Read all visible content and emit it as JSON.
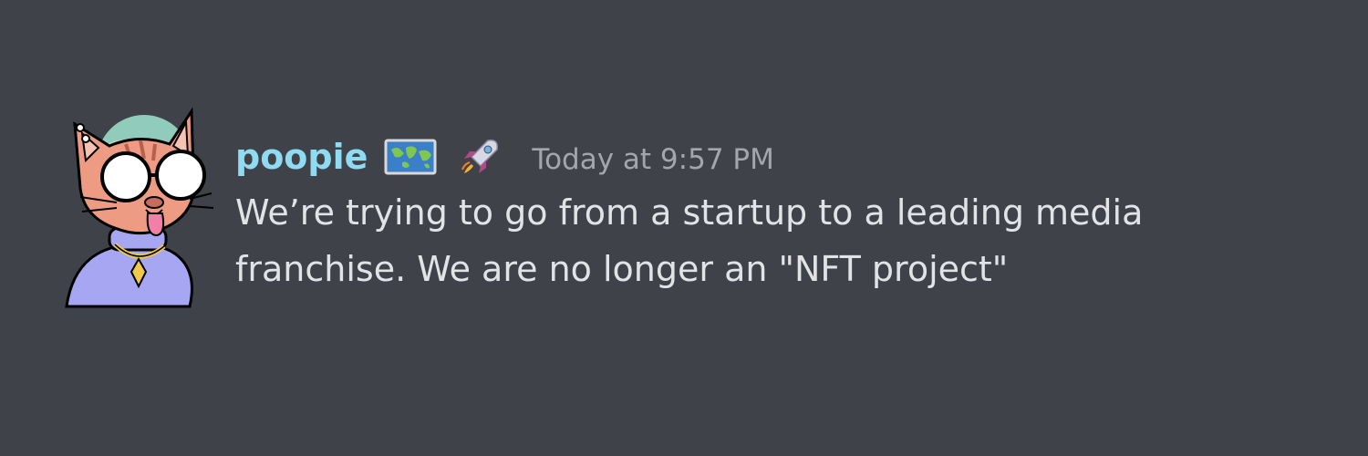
{
  "message": {
    "username": "poopie",
    "username_color": "#8fdcf2",
    "badges": [
      {
        "name": "world-map-icon"
      },
      {
        "name": "rocket-icon"
      }
    ],
    "timestamp": "Today at 9:57 PM",
    "lines": [
      "We’re trying to go from a startup to a leading media",
      "franchise. We are no longer an \"NFT project\""
    ]
  },
  "colors": {
    "background": "#404249",
    "text": "#e2e3e6",
    "timestamp": "#a3a6ad"
  }
}
